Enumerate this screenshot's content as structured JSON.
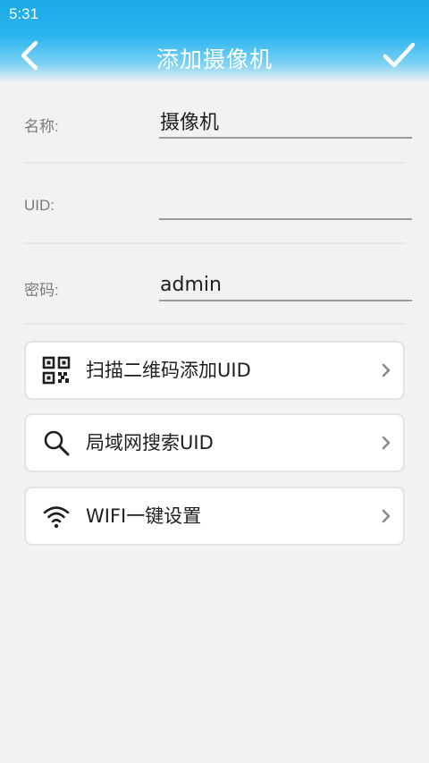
{
  "status_bar": {
    "time": "5:31"
  },
  "header": {
    "title": "添加摄像机",
    "back_icon": "chevron-left-icon",
    "confirm_icon": "checkmark-icon"
  },
  "form": {
    "name": {
      "label": "名称:",
      "value": "摄像机",
      "placeholder": ""
    },
    "uid": {
      "label": "UID:",
      "value": "",
      "placeholder": ""
    },
    "password": {
      "label": "密码:",
      "value": "admin",
      "placeholder": ""
    }
  },
  "actions": [
    {
      "label": "扫描二维码添加UID",
      "icon": "qr-code-icon"
    },
    {
      "label": "局域网搜索UID",
      "icon": "search-icon"
    },
    {
      "label": "WIFI一键设置",
      "icon": "wifi-icon"
    }
  ],
  "colors": {
    "header_top": "#1aa8e8",
    "background": "#f2f2f2",
    "text": "#1e1e1e",
    "label": "#7a7a7a"
  }
}
